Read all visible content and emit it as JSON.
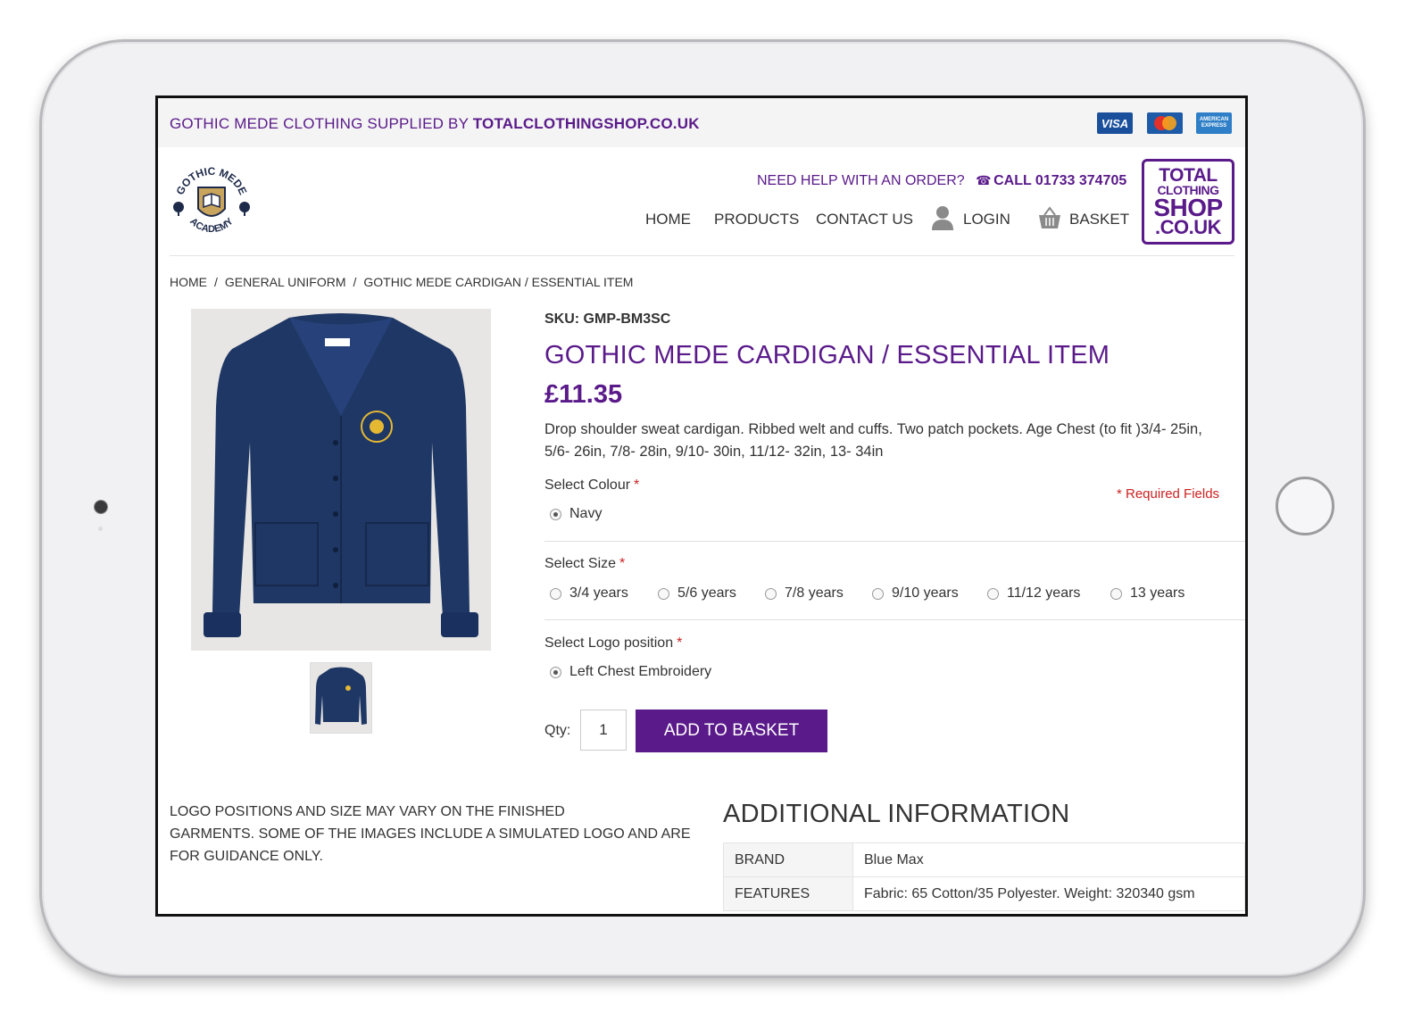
{
  "topbar": {
    "prefix": "GOTHIC MEDE CLOTHING SUPPLIED BY ",
    "site": "TOTALCLOTHINGSHOP.CO.UK",
    "payments": [
      "VISA",
      "MasterCard",
      "AMERICAN EXPRESS"
    ]
  },
  "school_logo": {
    "top": "GOTHIC MEDE",
    "bottom": "ACADEMY"
  },
  "help": {
    "text": "NEED HELP WITH AN ORDER?",
    "call": "CALL 01733 374705"
  },
  "nav": {
    "home": "HOME",
    "products": "PRODUCTS",
    "contact": "CONTACT US",
    "login": "LOGIN",
    "basket": "BASKET"
  },
  "shop_logo": {
    "l1": "TOTAL",
    "l2": "CLOTHING",
    "l3": "SHOP",
    "l4": ".CO.UK"
  },
  "breadcrumb": [
    "HOME",
    "GENERAL UNIFORM",
    "GOTHIC MEDE CARDIGAN / ESSENTIAL ITEM"
  ],
  "product": {
    "sku": "SKU: GMP-BM3SC",
    "title": "GOTHIC MEDE CARDIGAN / ESSENTIAL ITEM",
    "price": "£11.35",
    "description_line1": "Drop shoulder sweat cardigan. Ribbed welt and cuffs. Two patch pockets. Age Chest (to fit )3/4- 25in,",
    "description_line2": "5/6- 26in, 7/8- 28in, 9/10- 30in, 11/12- 32in, 13- 34in"
  },
  "options": {
    "colour": {
      "label": "Select Colour",
      "required": "*",
      "values": [
        "Navy"
      ],
      "selected": "Navy"
    },
    "size": {
      "label": "Select Size",
      "required": "*",
      "values": [
        "3/4 years",
        "5/6 years",
        "7/8 years",
        "9/10 years",
        "11/12 years",
        "13 years"
      ]
    },
    "logo": {
      "label": "Select Logo position",
      "required": "*",
      "values": [
        "Left Chest Embroidery"
      ],
      "selected": "Left Chest Embroidery"
    },
    "required_note": "* Required Fields"
  },
  "purchase": {
    "qty_label": "Qty:",
    "qty_value": "1",
    "add_button": "ADD TO BASKET"
  },
  "note": {
    "line1": "LOGO POSITIONS AND SIZE MAY VARY ON THE FINISHED",
    "line2": "GARMENTS. SOME OF THE IMAGES INCLUDE A SIMULATED LOGO AND ARE",
    "line3": "FOR GUIDANCE ONLY."
  },
  "additional": {
    "heading": "ADDITIONAL INFORMATION",
    "rows": [
      {
        "key": "BRAND",
        "value": "Blue Max"
      },
      {
        "key": "FEATURES",
        "value": "Fabric: 65 Cotton/35 Polyester. Weight: 320340 gsm"
      }
    ]
  },
  "colors": {
    "brand_purple": "#5a1a8a",
    "required_red": "#cc2222",
    "cardigan_navy": "#1e3764"
  }
}
